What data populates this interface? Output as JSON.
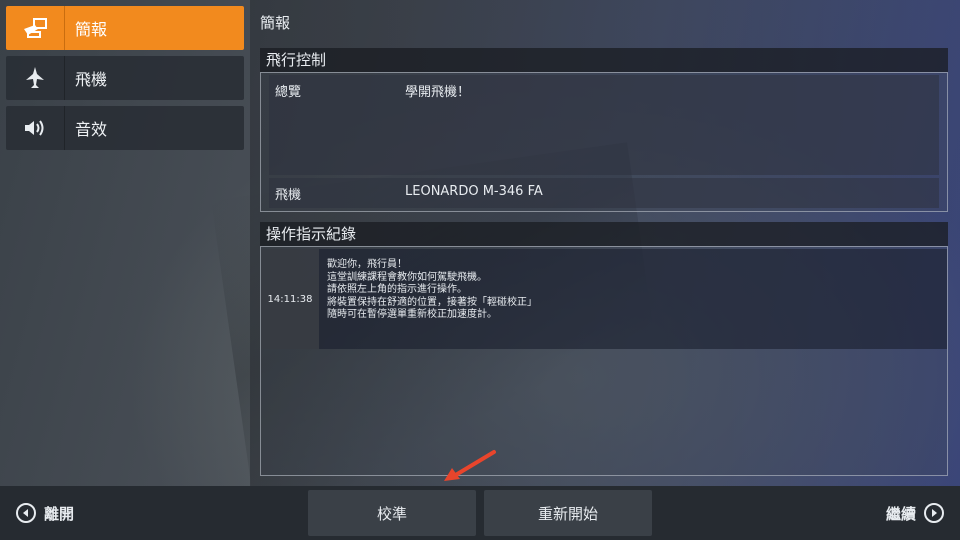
{
  "menu": {
    "items": [
      {
        "label": "簡報",
        "icon": "briefing-icon",
        "active": true
      },
      {
        "label": "飛機",
        "icon": "airplane-icon",
        "active": false
      },
      {
        "label": "音效",
        "icon": "speaker-icon",
        "active": false
      }
    ]
  },
  "page": {
    "title": "簡報"
  },
  "flight_control": {
    "header": "飛行控制",
    "overview_label": "總覽",
    "overview_value": "學開飛機！",
    "aircraft_label": "飛機",
    "aircraft_value": "LEONARDO M-346 FA"
  },
  "log": {
    "header": "操作指示紀錄",
    "entries": [
      {
        "time": "14:11:38",
        "lines": [
          "歡迎你，飛行員！",
          "這堂訓練課程會教你如何駕駛飛機。",
          "請依照左上角的指示進行操作。",
          "",
          "將裝置保持在舒適的位置，接著按「輕碰校正」",
          "隨時可在暫停選單重新校正加速度計。"
        ]
      }
    ]
  },
  "bottom": {
    "leave_label": "離開",
    "calibrate_label": "校準",
    "restart_label": "重新開始",
    "continue_label": "繼續"
  },
  "colors": {
    "accent": "#f28a1e",
    "annotation_arrow": "#e8452c"
  }
}
